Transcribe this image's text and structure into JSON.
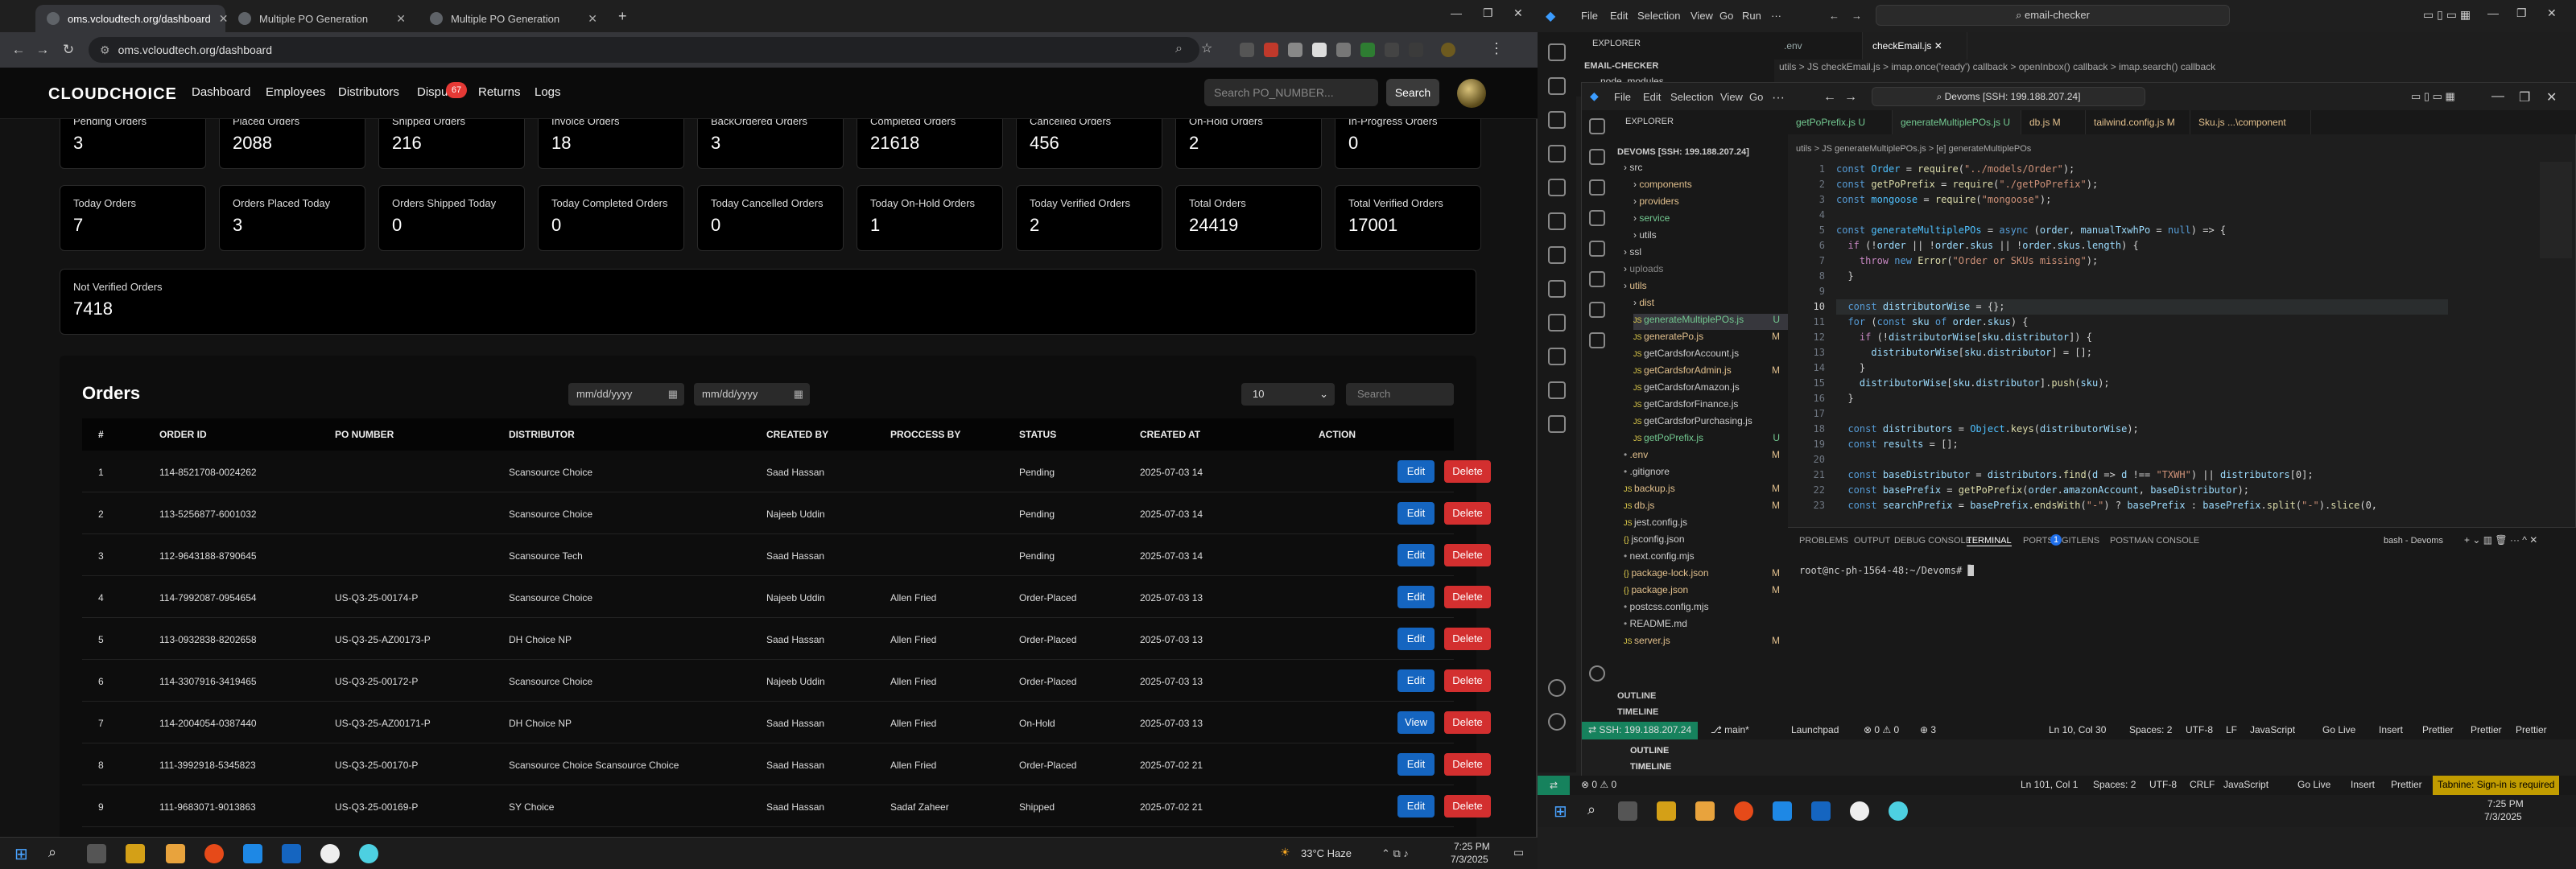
{
  "browser": {
    "tabs": [
      {
        "title": "oms.vcloudtech.org/dashboard"
      },
      {
        "title": "Multiple PO Generation"
      },
      {
        "title": "Multiple PO Generation"
      }
    ],
    "url": "oms.vcloudtech.org/dashboard"
  },
  "app": {
    "logo": "CLOUDCHOICE",
    "nav": [
      "Dashboard",
      "Employees",
      "Distributors",
      "Dispu",
      "Returns",
      "Logs"
    ],
    "dispute_badge": "67",
    "search_placeholder": "Search PO_NUMBER...",
    "search_button": "Search"
  },
  "stats_row1": [
    {
      "label": "Pending Orders",
      "value": "3"
    },
    {
      "label": "Placed Orders",
      "value": "2088"
    },
    {
      "label": "Shipped Orders",
      "value": "216"
    },
    {
      "label": "Invoice Orders",
      "value": "18"
    },
    {
      "label": "BackOrdered Orders",
      "value": "3"
    },
    {
      "label": "Completed Orders",
      "value": "21618"
    },
    {
      "label": "Cancelled Orders",
      "value": "456"
    },
    {
      "label": "On-Hold Orders",
      "value": "2"
    },
    {
      "label": "In-Progress Orders",
      "value": "0"
    }
  ],
  "stats_row2": [
    {
      "label": "Today Orders",
      "value": "7"
    },
    {
      "label": "Orders Placed Today",
      "value": "3"
    },
    {
      "label": "Orders Shipped Today",
      "value": "0"
    },
    {
      "label": "Today Completed Orders",
      "value": "0"
    },
    {
      "label": "Today Cancelled Orders",
      "value": "0"
    },
    {
      "label": "Today On-Hold Orders",
      "value": "1"
    },
    {
      "label": "Today Verified Orders",
      "value": "2"
    },
    {
      "label": "Total Orders",
      "value": "24419"
    },
    {
      "label": "Total Verified Orders",
      "value": "17001"
    }
  ],
  "not_verified": {
    "label": "Not Verified Orders",
    "value": "7418"
  },
  "orders": {
    "title": "Orders",
    "date_placeholder": "mm/dd/yyyy",
    "page_size": "10",
    "search_placeholder": "Search",
    "columns": [
      "#",
      "ORDER ID",
      "PO NUMBER",
      "DISTRIBUTOR",
      "CREATED BY",
      "PROCCESS BY",
      "STATUS",
      "CREATED AT",
      "ACTION"
    ],
    "rows": [
      {
        "n": "1",
        "order_id": "114-8521708-0024262",
        "po": "",
        "distributor": "Scansource Choice",
        "created_by": "Saad Hassan",
        "process_by": "",
        "status": "Pending",
        "created_at": "2025-07-03 14",
        "primary": "Edit"
      },
      {
        "n": "2",
        "order_id": "113-5256877-6001032",
        "po": "",
        "distributor": "Scansource Choice",
        "created_by": "Najeeb Uddin",
        "process_by": "",
        "status": "Pending",
        "created_at": "2025-07-03 14",
        "primary": "Edit"
      },
      {
        "n": "3",
        "order_id": "112-9643188-8790645",
        "po": "",
        "distributor": "Scansource Tech",
        "created_by": "Saad Hassan",
        "process_by": "",
        "status": "Pending",
        "created_at": "2025-07-03 14",
        "primary": "Edit"
      },
      {
        "n": "4",
        "order_id": "114-7992087-0954654",
        "po": "US-Q3-25-00174-P",
        "distributor": "Scansource Choice",
        "created_by": "Najeeb Uddin",
        "process_by": "Allen Fried",
        "status": "Order-Placed",
        "created_at": "2025-07-03 13",
        "primary": "Edit"
      },
      {
        "n": "5",
        "order_id": "113-0932838-8202658",
        "po": "US-Q3-25-AZ00173-P",
        "distributor": "DH Choice NP",
        "created_by": "Saad Hassan",
        "process_by": "Allen Fried",
        "status": "Order-Placed",
        "created_at": "2025-07-03 13",
        "primary": "Edit"
      },
      {
        "n": "6",
        "order_id": "114-3307916-3419465",
        "po": "US-Q3-25-00172-P",
        "distributor": "Scansource Choice",
        "created_by": "Najeeb Uddin",
        "process_by": "Allen Fried",
        "status": "Order-Placed",
        "created_at": "2025-07-03 13",
        "primary": "Edit"
      },
      {
        "n": "7",
        "order_id": "114-2004054-0387440",
        "po": "US-Q3-25-AZ00171-P",
        "distributor": "DH Choice NP",
        "created_by": "Saad Hassan",
        "process_by": "Allen Fried",
        "status": "On-Hold",
        "created_at": "2025-07-03 13",
        "primary": "View"
      },
      {
        "n": "8",
        "order_id": "111-3992918-5345823",
        "po": "US-Q3-25-00170-P",
        "distributor": "Scansource Choice Scansource Choice",
        "created_by": "Saad Hassan",
        "process_by": "Allen Fried",
        "status": "Order-Placed",
        "created_at": "2025-07-02 21",
        "primary": "Edit"
      },
      {
        "n": "9",
        "order_id": "111-9683071-9013863",
        "po": "US-Q3-25-00169-P",
        "distributor": "SY Choice",
        "created_by": "Saad Hassan",
        "process_by": "Sadaf Zaheer",
        "status": "Shipped",
        "created_at": "2025-07-02 21",
        "primary": "Edit"
      }
    ],
    "delete_label": "Delete"
  },
  "taskbar_left": {
    "weather": "33°C  Haze",
    "time": "7:25 PM",
    "date": "7/3/2025"
  },
  "vscode_outer": {
    "menus": [
      "File",
      "Edit",
      "Selection",
      "View",
      "Go",
      "Run"
    ],
    "search": "email-checker",
    "tabs": [
      ".env",
      "checkEmail.js"
    ],
    "breadcrumb": "utils > JS checkEmail.js > imap.once('ready') callback > openInbox() callback > imap.search() callback",
    "explorer_title": "EXPLORER",
    "project": "EMAIL-CHECKER",
    "first_item": "node_modules"
  },
  "vscode_inner": {
    "menus": [
      "File",
      "Edit",
      "Selection",
      "View",
      "Go"
    ],
    "search": "Devoms [SSH: 199.188.207.24]",
    "explorer_title": "EXPLORER",
    "project": "DEVOMS [SSH: 199.188.207.24]",
    "tabs": [
      "getPoPrefix.js U",
      "generateMultiplePOs.js U",
      "db.js M",
      "tailwind.config.js M",
      "Sku.js ...\\component"
    ],
    "breadcrumb": "utils > JS generateMultiplePOs.js > [e] generateMultiplePOs",
    "tree": [
      {
        "name": "src",
        "type": "folder",
        "indent": 1
      },
      {
        "name": "components",
        "type": "folder",
        "indent": 2,
        "color": "#e2c08d"
      },
      {
        "name": "providers",
        "type": "folder",
        "indent": 2,
        "color": "#e2c08d"
      },
      {
        "name": "service",
        "type": "folder",
        "indent": 2,
        "color": "#73c991"
      },
      {
        "name": "utils",
        "type": "folder",
        "indent": 2
      },
      {
        "name": "ssl",
        "type": "folder",
        "indent": 1
      },
      {
        "name": "uploads",
        "type": "folder",
        "indent": 1,
        "color": "#888888"
      },
      {
        "name": "utils",
        "type": "folder",
        "indent": 1,
        "color": "#e2c08d"
      },
      {
        "name": "dist",
        "type": "folder",
        "indent": 2,
        "color": "#e2c08d"
      },
      {
        "name": "generateMultiplePOs.js",
        "type": "js",
        "indent": 2,
        "badge": "U",
        "color": "#73c991",
        "active": true
      },
      {
        "name": "generatePo.js",
        "type": "js",
        "indent": 2,
        "badge": "M",
        "color": "#e2c08d"
      },
      {
        "name": "getCardsforAccount.js",
        "type": "js",
        "indent": 2
      },
      {
        "name": "getCardsforAdmin.js",
        "type": "js",
        "indent": 2,
        "badge": "M",
        "color": "#e2c08d"
      },
      {
        "name": "getCardsforAmazon.js",
        "type": "js",
        "indent": 2
      },
      {
        "name": "getCardsforFinance.js",
        "type": "js",
        "indent": 2
      },
      {
        "name": "getCardsforPurchasing.js",
        "type": "js",
        "indent": 2
      },
      {
        "name": "getPoPrefix.js",
        "type": "js",
        "indent": 2,
        "badge": "U",
        "color": "#73c991"
      },
      {
        "name": ".env",
        "type": "file",
        "indent": 1,
        "badge": "M",
        "color": "#e2c08d"
      },
      {
        "name": ".gitignore",
        "type": "file",
        "indent": 1
      },
      {
        "name": "backup.js",
        "type": "js",
        "indent": 1,
        "badge": "M",
        "color": "#e2c08d"
      },
      {
        "name": "db.js",
        "type": "js",
        "indent": 1,
        "badge": "M",
        "color": "#e2c08d"
      },
      {
        "name": "jest.config.js",
        "type": "js",
        "indent": 1
      },
      {
        "name": "jsconfig.json",
        "type": "json",
        "indent": 1
      },
      {
        "name": "next.config.mjs",
        "type": "file",
        "indent": 1
      },
      {
        "name": "package-lock.json",
        "type": "json",
        "indent": 1,
        "badge": "M",
        "color": "#e2c08d"
      },
      {
        "name": "package.json",
        "type": "json",
        "indent": 1,
        "badge": "M",
        "color": "#e2c08d"
      },
      {
        "name": "postcss.config.mjs",
        "type": "file",
        "indent": 1
      },
      {
        "name": "README.md",
        "type": "file",
        "indent": 1
      },
      {
        "name": "server.js",
        "type": "js",
        "indent": 1,
        "badge": "M",
        "color": "#e2c08d"
      }
    ],
    "outline": "OUTLINE",
    "timeline": "TIMELINE",
    "panel_tabs": [
      "PROBLEMS",
      "OUTPUT",
      "DEBUG CONSOLE",
      "TERMINAL",
      "PORTS",
      "GITLENS",
      "POSTMAN CONSOLE"
    ],
    "ports_badge": "1",
    "terminal_name": "bash - Devoms",
    "terminal_prompt": "root@nc-ph-1564-48:~/Devoms# ",
    "status": {
      "remote": "SSH: 199.188.207.24",
      "branch": "main*",
      "launchpad": "Launchpad",
      "problems": "⊗ 0 ⚠ 0",
      "ports": "3",
      "position": "Ln 10, Col 30",
      "spaces": "Spaces: 2",
      "encoding": "UTF-8",
      "eol": "LF",
      "language": "JavaScript",
      "golive": "Go Live",
      "insert": "Insert",
      "prettier": "Prettier"
    }
  },
  "vscode_outer_status": {
    "problems": "⊗ 0 ⚠ 0",
    "position": "Ln 101, Col 1",
    "spaces": "Spaces: 2",
    "encoding": "UTF-8",
    "eol": "CRLF",
    "language": "JavaScript",
    "golive": "Go Live",
    "insert": "Insert",
    "prettier": "Prettier",
    "tabnine": "Tabnine: Sign-in is required"
  },
  "taskbar_right": {
    "time": "7:25 PM",
    "date": "7/3/2025"
  },
  "code_lines": [
    "const Order = require(\"../models/Order\");",
    "const getPoPrefix = require(\"./getPoPrefix\");",
    "const mongoose = require(\"mongoose\");",
    "",
    "const generateMultiplePOs = async (order, manualTxwhPo = null) => {",
    "  if (!order || !order.skus || !order.skus.length) {",
    "    throw new Error(\"Order or SKUs missing\");",
    "  }",
    "",
    "  const distributorWise = {};",
    "  for (const sku of order.skus) {",
    "    if (!distributorWise[sku.distributor]) {",
    "      distributorWise[sku.distributor] = [];",
    "    }",
    "    distributorWise[sku.distributor].push(sku);",
    "  }",
    "",
    "  const distributors = Object.keys(distributorWise);",
    "  const results = [];",
    "",
    "  const baseDistributor = distributors.find(d => d !== \"TXWH\") || distributors[0];",
    "  const basePrefix = getPoPrefix(order.amazonAccount, baseDistributor);",
    "  const searchPrefix = basePrefix.endsWith(\"-\") ? basePrefix : basePrefix.split(\"-\").slice(0,"
  ]
}
